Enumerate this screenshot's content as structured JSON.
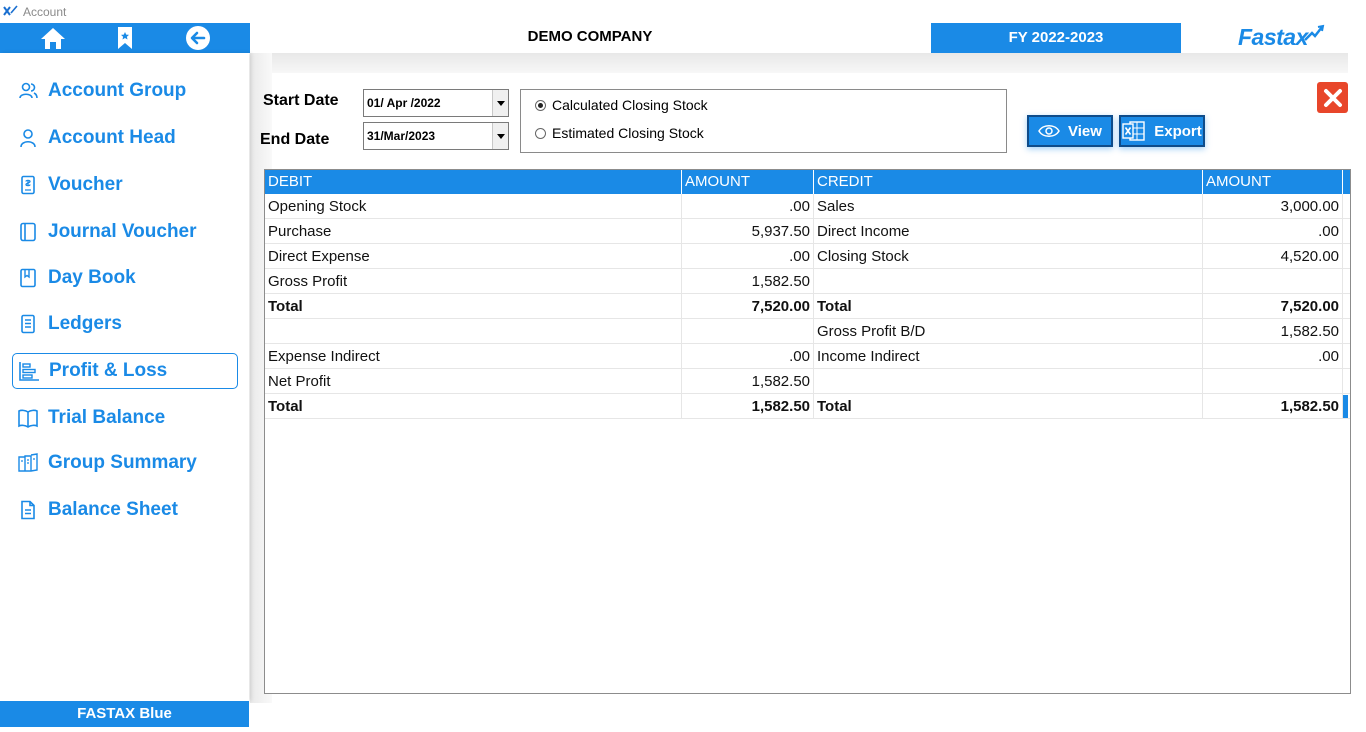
{
  "window": {
    "title": "Account"
  },
  "header": {
    "company": "DEMO COMPANY",
    "fiscal_year": "FY 2022-2023",
    "brand": "Fastax"
  },
  "sidebar": {
    "items": [
      {
        "label": "Account Group",
        "icon": "users-icon"
      },
      {
        "label": "Account Head",
        "icon": "user-icon"
      },
      {
        "label": "Voucher",
        "icon": "receipt-icon"
      },
      {
        "label": "Journal Voucher",
        "icon": "journal-icon"
      },
      {
        "label": "Day Book",
        "icon": "book-icon"
      },
      {
        "label": "Ledgers",
        "icon": "ledger-icon"
      },
      {
        "label": "Profit & Loss",
        "icon": "bar-chart-icon",
        "active": true
      },
      {
        "label": "Trial Balance",
        "icon": "open-book-icon"
      },
      {
        "label": "Group Summary",
        "icon": "summary-icon"
      },
      {
        "label": "Balance Sheet",
        "icon": "document-icon"
      }
    ],
    "footer": "FASTAX Blue"
  },
  "form": {
    "start_date_label": "Start Date",
    "end_date_label": "End Date",
    "start_date": "01/ Apr /2022",
    "end_date": "31/Mar/2023",
    "stock_options": [
      {
        "label": "Calculated Closing Stock",
        "selected": true
      },
      {
        "label": "Estimated  Closing Stock",
        "selected": false
      }
    ],
    "view_label": "View",
    "export_label": "Export"
  },
  "grid": {
    "columns": [
      "DEBIT",
      "AMOUNT",
      "CREDIT",
      "AMOUNT"
    ],
    "rows": [
      {
        "debit": "Opening Stock",
        "d_amount": ".00",
        "credit": " Sales",
        "c_amount": "3,000.00",
        "bold": false
      },
      {
        "debit": "Purchase",
        "d_amount": "5,937.50",
        "credit": "Direct Income",
        "c_amount": ".00",
        "bold": false
      },
      {
        "debit": "Direct Expense",
        "d_amount": ".00",
        "credit": "Closing Stock",
        "c_amount": "4,520.00",
        "bold": false
      },
      {
        "debit": "Gross Profit",
        "d_amount": "1,582.50",
        "credit": "",
        "c_amount": "",
        "bold": false
      },
      {
        "debit": " Total",
        "d_amount": "7,520.00",
        "credit": "Total",
        "c_amount": "7,520.00",
        "bold": true
      },
      {
        "debit": "",
        "d_amount": "",
        "credit": "Gross Profit B/D",
        "c_amount": "1,582.50",
        "bold": false
      },
      {
        "debit": "Expense Indirect",
        "d_amount": ".00",
        "credit": "Income Indirect",
        "c_amount": ".00",
        "bold": false
      },
      {
        "debit": "Net Profit",
        "d_amount": "1,582.50",
        "credit": "",
        "c_amount": "",
        "bold": false
      },
      {
        "debit": " Total",
        "d_amount": "1,582.50",
        "credit": "Total",
        "c_amount": "1,582.50",
        "bold": true
      }
    ]
  },
  "colors": {
    "accent": "#1a8ae6",
    "close": "#e8462a"
  }
}
